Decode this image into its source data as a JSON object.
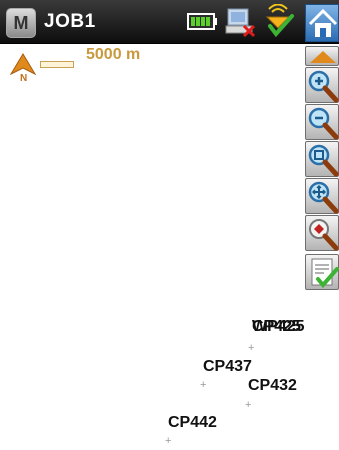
{
  "header": {
    "menu_icon_letter": "M",
    "job_title": "JOB1"
  },
  "map": {
    "scale_label": "5000 m",
    "north_letter": "N",
    "points": [
      {
        "label": "CP425"
      },
      {
        "label": "WP425"
      },
      {
        "label": "CP437"
      },
      {
        "label": "CP432"
      },
      {
        "label": "CP442"
      }
    ],
    "point_marker": "+"
  },
  "colors": {
    "title_bar": "#111111",
    "scale_text": "#c99a3d",
    "north_arrow": "#e08a1e",
    "home_blue": "#2a6cb3",
    "battery_green": "#5bd02a"
  },
  "icons": {
    "menu": "menu-icon",
    "battery": "battery-icon",
    "radio": "radio-disconnected-icon",
    "gnss": "gnss-satellite-icon",
    "home": "home-icon",
    "scroll_up": "triangle-up-icon",
    "zoom_in": "zoom-in-icon",
    "zoom_out": "zoom-out-icon",
    "zoom_extents": "zoom-extents-icon",
    "pan": "pan-icon",
    "filter": "filter-icon",
    "review": "review-list-icon"
  }
}
